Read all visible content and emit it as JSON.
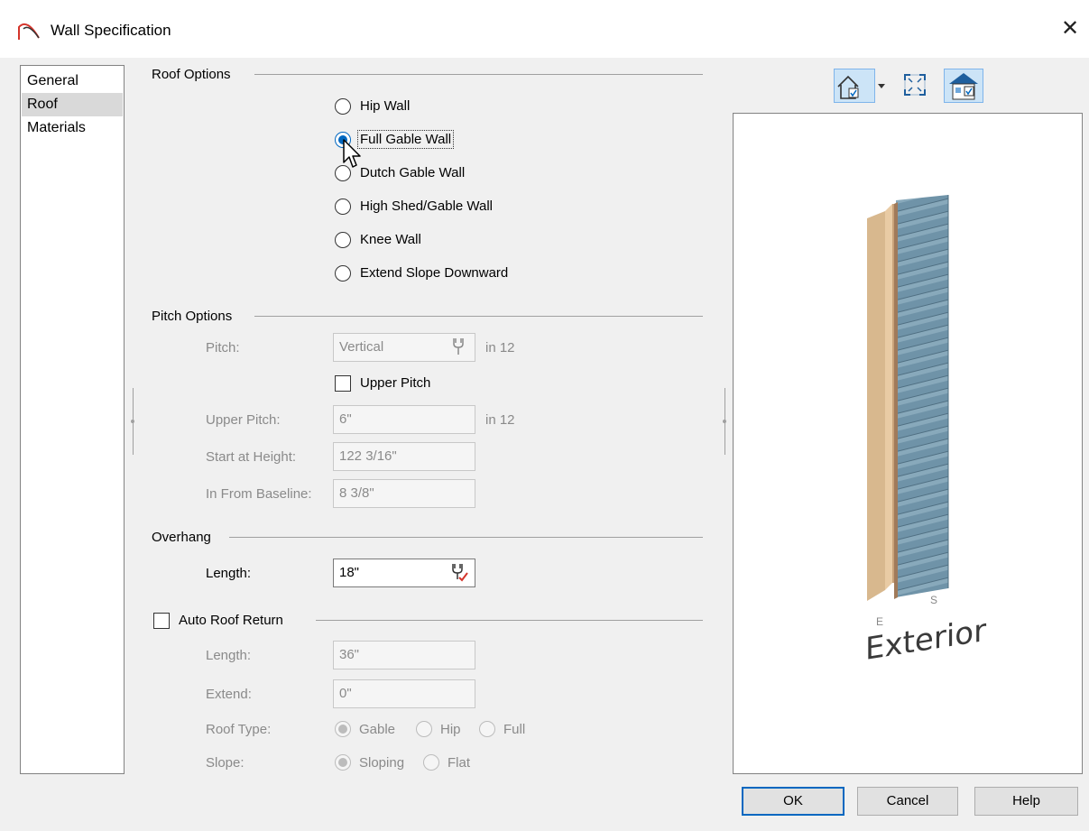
{
  "window": {
    "title": "Wall Specification"
  },
  "nav": {
    "items": [
      "General",
      "Roof",
      "Materials"
    ],
    "selected": "Roof"
  },
  "roof_options": {
    "title": "Roof Options",
    "options": [
      "Hip Wall",
      "Full Gable Wall",
      "Dutch Gable Wall",
      "High Shed/Gable Wall",
      "Knee Wall",
      "Extend Slope Downward"
    ],
    "selected": "Full Gable Wall"
  },
  "pitch_options": {
    "title": "Pitch Options",
    "pitch_label": "Pitch:",
    "pitch_value": "Vertical",
    "pitch_unit": "in 12",
    "upper_pitch_checkbox": "Upper Pitch",
    "upper_pitch_label": "Upper Pitch:",
    "upper_pitch_value": "6\"",
    "upper_pitch_unit": "in 12",
    "start_height_label": "Start at Height:",
    "start_height_value": "122 3/16\"",
    "baseline_label": "In From Baseline:",
    "baseline_value": "8 3/8\""
  },
  "overhang": {
    "title": "Overhang",
    "length_label": "Length:",
    "length_value": "18\""
  },
  "auto_roof_return": {
    "title": "Auto Roof Return",
    "length_label": "Length:",
    "length_value": "36\"",
    "extend_label": "Extend:",
    "extend_value": "0\"",
    "roof_type_label": "Roof Type:",
    "roof_types": [
      "Gable",
      "Hip",
      "Full"
    ],
    "slope_label": "Slope:",
    "slopes": [
      "Sloping",
      "Flat"
    ]
  },
  "preview": {
    "label_e": "E",
    "label_s": "S",
    "exterior": "Exterior"
  },
  "buttons": {
    "ok": "OK",
    "cancel": "Cancel",
    "help": "Help"
  },
  "colors": {
    "accent": "#0067c0",
    "siding": "#6f93a8",
    "wood": "#e9cba4"
  },
  "icons": [
    "wall-arc-icon",
    "close-icon",
    "house-checkbox-icon",
    "dropdown-arrow-icon",
    "fit-view-icon",
    "house-view-icon",
    "wrench-icon",
    "wrench-check-icon",
    "cursor-pointer-icon"
  ]
}
